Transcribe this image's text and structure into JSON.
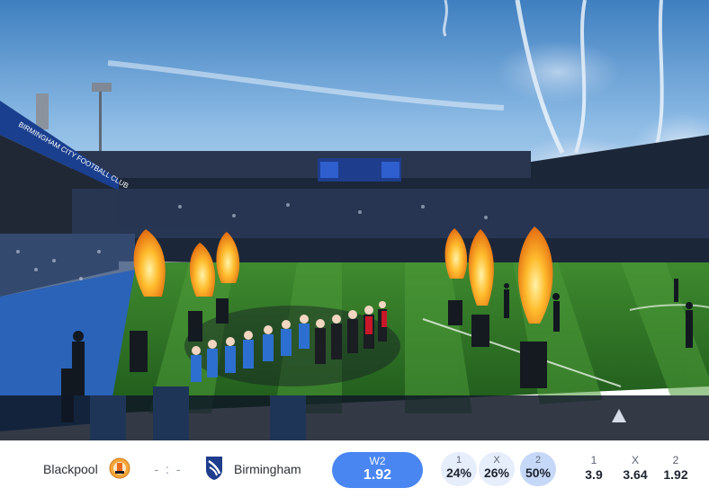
{
  "match": {
    "home_team": "Blackpool",
    "away_team": "Birmingham",
    "score": "- : -",
    "home_crest_icon": "blackpool-crest-icon",
    "away_crest_icon": "birmingham-crest-icon"
  },
  "pick": {
    "label": "W2",
    "value": "1.92",
    "color": "#4a86f2"
  },
  "probabilities": [
    {
      "label": "1",
      "value": "24%"
    },
    {
      "label": "X",
      "value": "26%"
    },
    {
      "label": "2",
      "value": "50%"
    }
  ],
  "odds": [
    {
      "label": "1",
      "value": "3.9"
    },
    {
      "label": "X",
      "value": "3.64"
    },
    {
      "label": "2",
      "value": "1.92"
    }
  ],
  "hero_image": {
    "description_icon": "stadium-photo",
    "stand_banner_text": "BIRMINGHAM CITY FOOTBALL CLUB"
  }
}
